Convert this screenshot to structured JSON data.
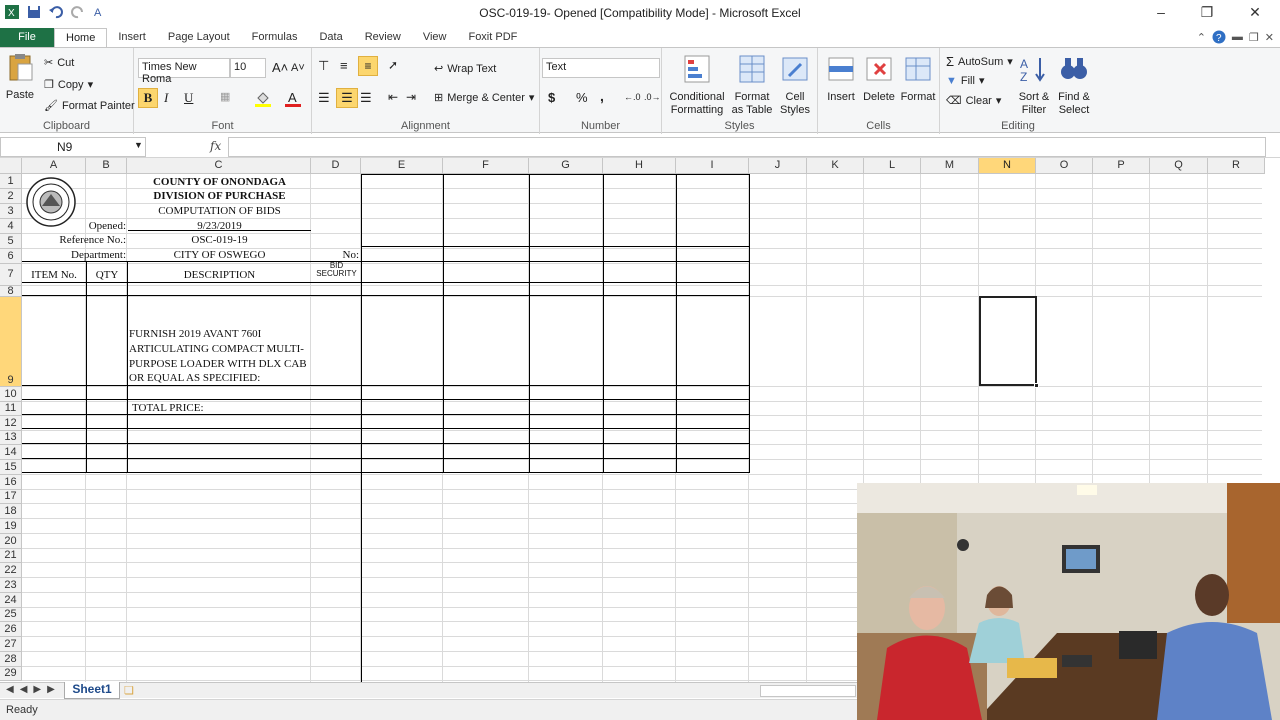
{
  "window": {
    "title": "OSC-019-19- Opened  [Compatibility Mode] - Microsoft Excel"
  },
  "tabs": [
    "File",
    "Home",
    "Insert",
    "Page Layout",
    "Formulas",
    "Data",
    "Review",
    "View",
    "Foxit PDF"
  ],
  "ribbon": {
    "clipboard": {
      "label": "Clipboard",
      "paste": "Paste",
      "cut": "Cut",
      "copy": "Copy",
      "format_painter": "Format Painter"
    },
    "font": {
      "label": "Font",
      "family": "Times New Roma",
      "size": "10",
      "bold": "B",
      "italic": "I",
      "underline": "U"
    },
    "alignment": {
      "label": "Alignment",
      "wrap": "Wrap Text",
      "merge": "Merge & Center"
    },
    "number": {
      "label": "Number",
      "format": "Text",
      "currency": "$",
      "percent": "%",
      "comma": ","
    },
    "styles": {
      "label": "Styles",
      "conditional": "Conditional",
      "conditional2": "Formatting",
      "format_table": "Format",
      "format_table2": "as Table",
      "cell": "Cell",
      "cell2": "Styles"
    },
    "cells": {
      "label": "Cells",
      "insert": "Insert",
      "delete": "Delete",
      "format": "Format"
    },
    "editing": {
      "label": "Editing",
      "autosum": "AutoSum",
      "fill": "Fill",
      "clear": "Clear",
      "sort": "Sort &",
      "sort2": "Filter",
      "find": "Find &",
      "find2": "Select"
    }
  },
  "formula_bar": {
    "name_box": "N9",
    "fx": "fx",
    "value": ""
  },
  "columns": [
    "A",
    "B",
    "C",
    "D",
    "E",
    "F",
    "G",
    "H",
    "I",
    "J",
    "K",
    "L",
    "M",
    "N",
    "O",
    "P",
    "Q",
    "R"
  ],
  "rows": [
    "1",
    "2",
    "3",
    "4",
    "5",
    "6",
    "7",
    "8",
    "9",
    "10",
    "11",
    "12",
    "13",
    "14",
    "15",
    "16",
    "17",
    "18",
    "19",
    "20",
    "21",
    "22",
    "23",
    "24",
    "25",
    "26",
    "27",
    "28",
    "29"
  ],
  "selected_cell": "N9",
  "sheet": {
    "header1": "COUNTY OF ONONDAGA",
    "header2": "DIVISION OF PURCHASE",
    "header3": "COMPUTATION OF BIDS",
    "opened_label": "Opened:",
    "opened_value": "9/23/2019",
    "ref_label": "Reference No.:",
    "ref_value": "OSC-019-19",
    "dept_label": "Department:",
    "dept_value": "CITY OF OSWEGO",
    "no_label": "No:",
    "col_item": "ITEM No.",
    "col_qty": "QTY",
    "col_desc": "DESCRIPTION",
    "col_bid1": "BID",
    "col_bid2": "SECURITY",
    "desc_line1": "FURNISH 2019 AVANT 760I",
    "desc_line2": "ARTICULATING COMPACT MULTI-",
    "desc_line3": "PURPOSE LOADER WITH DLX CAB",
    "desc_line4": "OR EQUAL AS SPECIFIED:",
    "total_label": "TOTAL PRICE:"
  },
  "sheet_tab": "Sheet1",
  "status": "Ready"
}
